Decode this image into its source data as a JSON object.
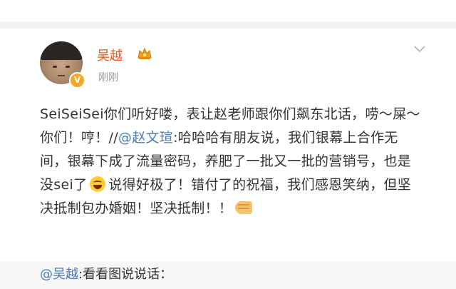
{
  "author": {
    "name": "吴越",
    "time": "刚刚",
    "verified_badge": "V",
    "badge_icon": "crown-icon"
  },
  "post": {
    "part1": "SeiSeiSei你们听好喽，表让赵老师跟你们飙东北话，唠～屎～你们！哼！//",
    "mention": "@赵文瑄",
    "part2": ":哈哈哈有朋友说，我们银幕上合作无间，银幕下成了流量密码，养肥了一批又一批的营销号，也是没sei了",
    "part3": "说得好极了！错付了的祝福，我们感恩笑纳，但坚决抵制包办婚姻！坚决抵制！！",
    "emojis": [
      "laughing-emoji",
      "fist-emoji"
    ]
  },
  "repost": {
    "mention": "@吴越",
    "text": ":看看图说说话："
  },
  "colors": {
    "name": "#e8561c",
    "mention": "#4a7ab8",
    "text": "#333333",
    "muted": "#999999",
    "divider": "#f2f2f2"
  }
}
